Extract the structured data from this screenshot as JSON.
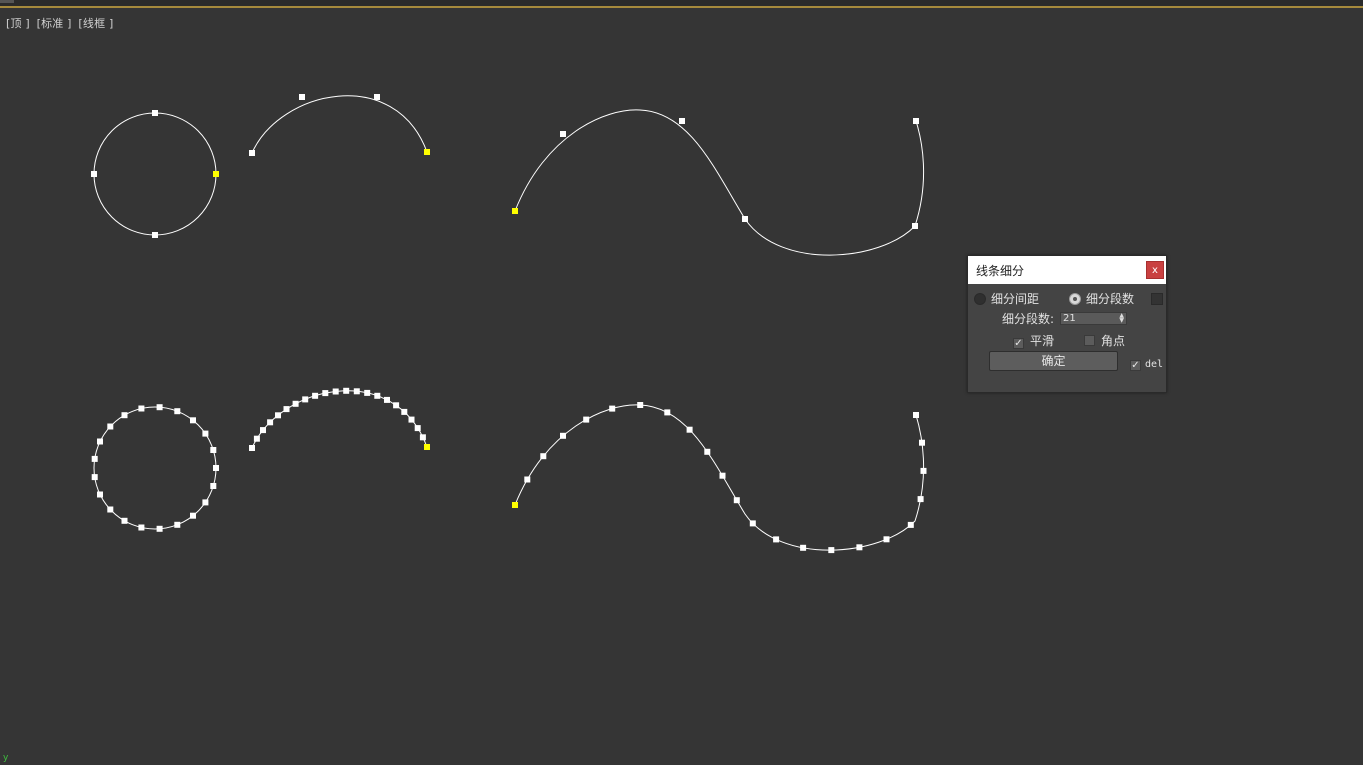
{
  "viewport": {
    "labels": [
      "[顶 ]",
      "[标准 ]",
      "[线框 ]"
    ],
    "background": "#353535",
    "accent_border": "#a68a3c",
    "spline_color": "#ffffff",
    "vertex_color": "#ffffff",
    "first_vertex_color": "#ffff00",
    "axis_glyph": "y"
  },
  "dialog": {
    "title": "线条细分",
    "close_label": "x",
    "mode_options": [
      {
        "label": "细分间距",
        "selected": false
      },
      {
        "label": "细分段数",
        "selected": true
      }
    ],
    "segments_label": "细分段数:",
    "segments_value": "21",
    "smooth": {
      "label": "平滑",
      "checked": true
    },
    "corner": {
      "label": "角点",
      "checked": false
    },
    "ok_label": "确定",
    "del": {
      "label": "del",
      "checked": true
    },
    "close_color": "#c94040"
  }
}
